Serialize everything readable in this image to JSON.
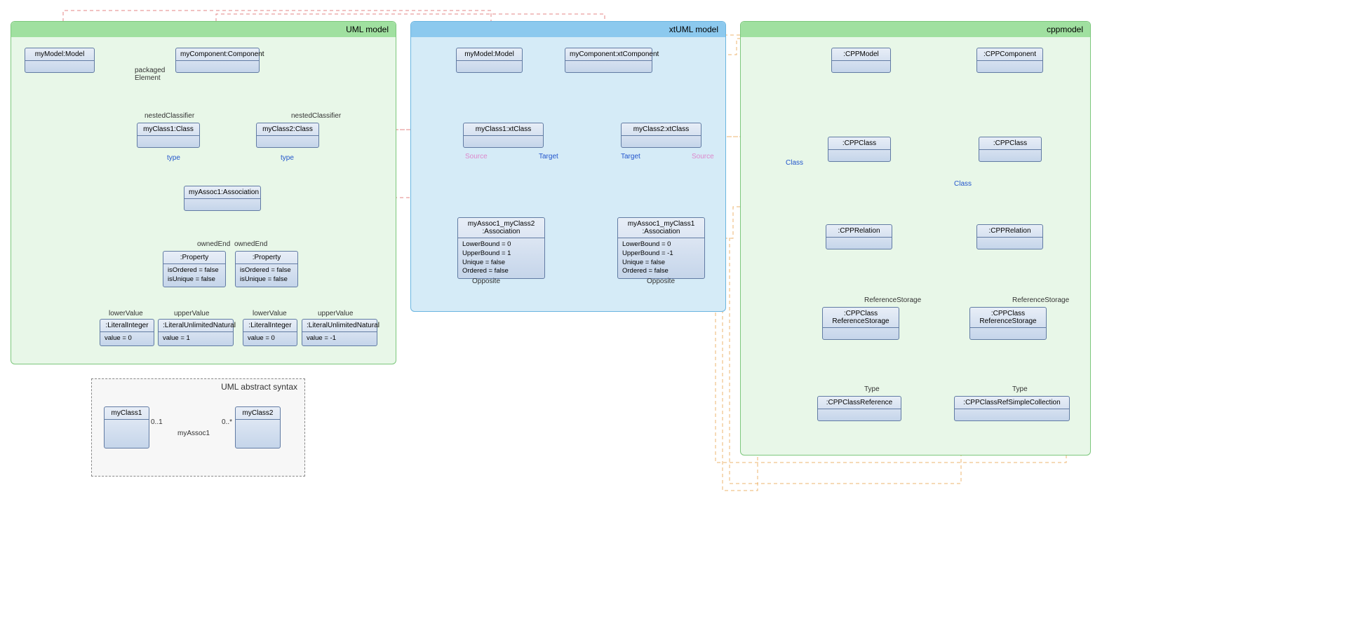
{
  "regions": {
    "uml": "UML model",
    "xtuml": "xtUML model",
    "cpp": "cppmodel",
    "abstract": "UML abstract syntax"
  },
  "uml": {
    "model": "myModel:Model",
    "component": "myComponent:Component",
    "class1": "myClass1:Class",
    "class2": "myClass2:Class",
    "assoc": "myAssoc1:Association",
    "prop1": {
      "title": ":Property",
      "l1": "isOrdered = false",
      "l2": "isUnique = false"
    },
    "prop2": {
      "title": ":Property",
      "l1": "isOrdered = false",
      "l2": "isUnique = false"
    },
    "li1": {
      "title": ":LiteralInteger",
      "val": "value = 0"
    },
    "lu1": {
      "title": ":LiteralUnlimitedNatural",
      "val": "value = 1"
    },
    "li2": {
      "title": ":LiteralInteger",
      "val": "value = 0"
    },
    "lu2": {
      "title": ":LiteralUnlimitedNatural",
      "val": "value = -1"
    },
    "labels": {
      "packaged": "packaged\nElement",
      "nested1": "nestedClassifier",
      "nested2": "nestedClassifier",
      "type1": "type",
      "type2": "type",
      "owned1": "ownedEnd",
      "owned2": "ownedEnd",
      "lower1": "lowerValue",
      "upper1": "upperValue",
      "lower2": "lowerValue",
      "upper2": "upperValue"
    }
  },
  "xtuml": {
    "model": "myModel:Model",
    "component": "myComponent:xtComponent",
    "class1": "myClass1:xtClass",
    "class2": "myClass2:xtClass",
    "assoc1": {
      "title": "myAssoc1_myClass2\n:Association",
      "l1": "LowerBound = 0",
      "l2": "UpperBound = 1",
      "l3": "Unique = false",
      "l4": "Ordered = false"
    },
    "assoc2": {
      "title": "myAssoc1_myClass1\n:Association",
      "l1": "LowerBound = 0",
      "l2": "UpperBound = -1",
      "l3": "Unique = false",
      "l4": "Ordered = false"
    },
    "labels": {
      "source1": "Source",
      "target1": "Target",
      "target2": "Target",
      "source2": "Source",
      "opposite1": "Opposite",
      "opposite2": "Opposite"
    }
  },
  "cpp": {
    "model": ":CPPModel",
    "component": ":CPPComponent",
    "class1": ":CPPClass",
    "class2": ":CPPClass",
    "rel1": ":CPPRelation",
    "rel2": ":CPPRelation",
    "refstore1": ":CPPClass\nReferenceStorage",
    "refstore2": ":CPPClass\nReferenceStorage",
    "ref1": ":CPPClassReference",
    "ref2": ":CPPClassRefSimpleCollection",
    "labels": {
      "class1": "Class",
      "class2": "Class",
      "refstore1": "ReferenceStorage",
      "refstore2": "ReferenceStorage",
      "type1": "Type",
      "type2": "Type"
    }
  },
  "abstract": {
    "class1": "myClass1",
    "class2": "myClass2",
    "assoc": "myAssoc1",
    "m1": "0..1",
    "m2": "0..*"
  }
}
